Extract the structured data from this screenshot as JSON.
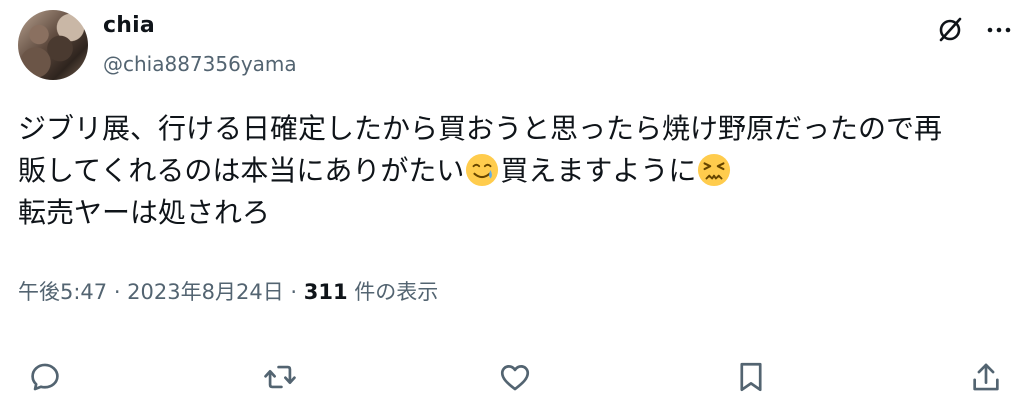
{
  "author": {
    "display_name": "chia",
    "handle": "@chia887356yama",
    "avatar_icon": "cat-photo-avatar"
  },
  "header_icons": {
    "grok": "grok-icon",
    "more": "more-icon"
  },
  "tweet": {
    "line1": "ジブリ展、行ける日確定したから買おうと思ったら焼け野原だったので再",
    "line2_a": "販してくれるのは本当にありがたい",
    "line2_b": "買えますように",
    "line3": "転売ヤーは処されろ",
    "emoji_1": "smiling-face-with-tear-emoji",
    "emoji_2": "confounded-face-emoji"
  },
  "meta": {
    "time_date": "午後5:47 · 2023年8月24日 · ",
    "view_count": "311",
    "view_suffix": " 件の表示"
  },
  "actions": [
    {
      "icon": "reply-icon"
    },
    {
      "icon": "retweet-icon"
    },
    {
      "icon": "like-icon"
    },
    {
      "icon": "bookmark-icon"
    },
    {
      "icon": "share-icon"
    }
  ],
  "colors": {
    "text_primary": "#0f1419",
    "text_secondary": "#536471",
    "emoji_yellow": "#ffcc4d"
  }
}
